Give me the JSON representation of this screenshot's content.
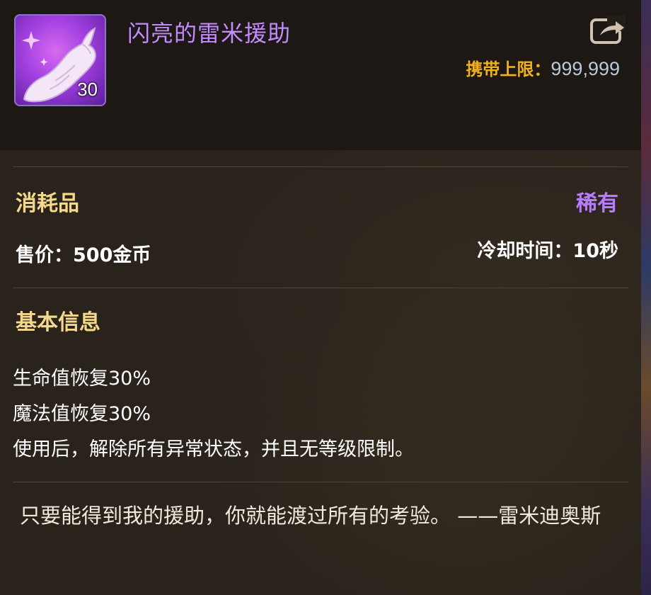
{
  "item": {
    "name": "闪亮的雷米援助",
    "count": "30",
    "icon": "pink-glove-icon",
    "carry_label": "携带上限：",
    "carry_value": "999,999",
    "share_icon": "share-export-icon"
  },
  "info": {
    "type": "消耗品",
    "rarity": "稀有",
    "price": "售价：500金币",
    "cooldown": "冷却时间：10秒"
  },
  "basic": {
    "title": "基本信息",
    "effects": [
      "生命值恢复30%",
      "魔法值恢复30%",
      "使用后，解除所有异常状态，并且无等级限制。"
    ]
  },
  "flavor": "只要能得到我的援助，你就能渡过所有的考验。 ——雷米迪奥斯",
  "colors": {
    "name": "#c28bff",
    "rarity": "#b77bff",
    "section": "#f4d88c",
    "carry_label": "#f0b020",
    "icon_border": "#8c73c8"
  }
}
